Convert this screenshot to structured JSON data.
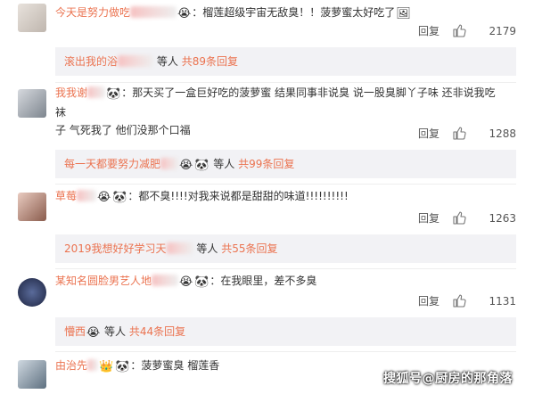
{
  "comments": [
    {
      "username": "今天是努力做吃",
      "text": "：榴莲超级宇宙无敌臭！！菠萝蜜太好吃了",
      "reply_label": "回复",
      "likes": "2179",
      "sub_user": "滚出我的浴",
      "sub_suffix": "等人",
      "sub_more": "共89条回复"
    },
    {
      "username": "我我谢",
      "text_line1": "：那天买了一盒巨好吃的菠萝蜜 结果同事非说臭  说一股臭脚丫子味  还非说我吃袜",
      "text_line2": "子  气死我了 他们没那个口福",
      "reply_label": "回复",
      "likes": "1288",
      "sub_user": "每一天都要努力减肥",
      "sub_suffix": "等人",
      "sub_more": "共99条回复"
    },
    {
      "username": "草莓",
      "text": "：都不臭!!!!对我来说都是甜甜的味道!!!!!!!!!!",
      "reply_label": "回复",
      "likes": "1263",
      "sub_user": "2019我想好好学习天",
      "sub_suffix": "等人",
      "sub_more": "共55条回复"
    },
    {
      "username": "某知名圆脸男艺人地",
      "text": "：在我眼里，差不多臭",
      "reply_label": "回复",
      "likes": "1131",
      "sub_user": "懵西",
      "sub_suffix": "等人",
      "sub_more": "共44条回复"
    },
    {
      "username": "由治先",
      "text": "：菠萝蜜臭  榴莲香"
    }
  ],
  "watermark": "搜狐号@厨房的那角落",
  "colors": {
    "username": "#eb7350",
    "subbox_bg": "#f2f2f5",
    "separator": "#eeeeee"
  },
  "icons": {
    "like": "thumbs-up-icon",
    "emoji_crying": "crying-face-icon",
    "emoji_panda": "panda-icon"
  }
}
